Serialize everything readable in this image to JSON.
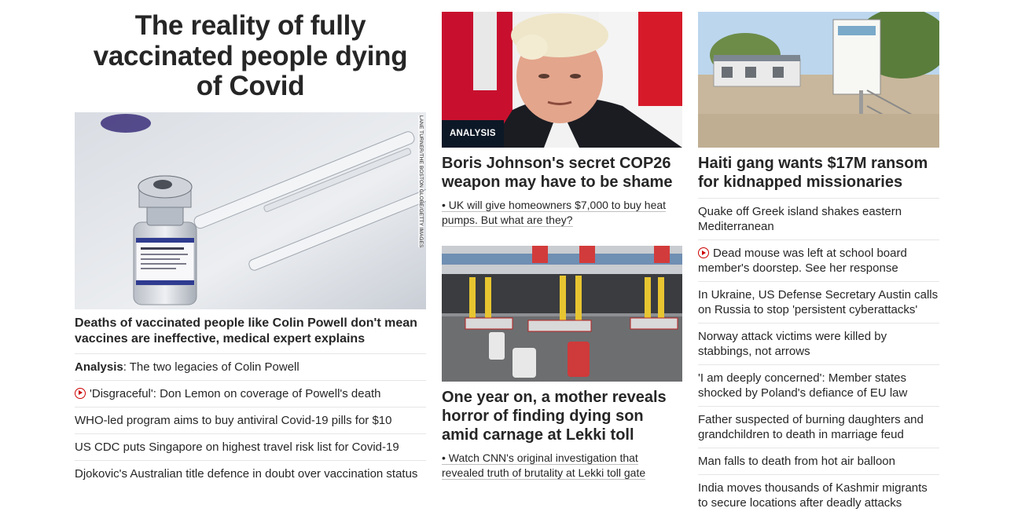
{
  "col1": {
    "lead_title": "The reality of fully vaccinated people dying of Covid",
    "image_credit": "LANE TURNER/THE BOSTON GLOBE/GETTY IMAGES",
    "headline": "Deaths of vaccinated people like Colin Powell don't mean vaccines are ineffective, medical expert explains",
    "items": [
      {
        "prefix": "Analysis",
        "text": ": The two legacies of Colin Powell",
        "video": false
      },
      {
        "prefix": "",
        "text": "'Disgraceful': Don Lemon on coverage of Powell's death",
        "video": true
      },
      {
        "prefix": "",
        "text": "WHO-led program aims to buy antiviral Covid-19 pills for $10",
        "video": false
      },
      {
        "prefix": "",
        "text": "US CDC puts Singapore on highest travel risk list for Covid-19",
        "video": false
      },
      {
        "prefix": "",
        "text": "Djokovic's Australian title defence in doubt over vaccination status",
        "video": false
      }
    ]
  },
  "col2": {
    "story1": {
      "tag": "ANALYSIS",
      "headline": "Boris Johnson's secret COP26 weapon may have to be shame",
      "sub": "• UK will give homeowners $7,000 to buy heat pumps. But what are they?"
    },
    "story2": {
      "headline": "One year on, a mother reveals horror of finding dying son amid carnage at Lekki toll",
      "sub": "• Watch CNN's original investigation that revealed truth of brutality at Lekki toll gate"
    }
  },
  "col3": {
    "headline": "Haiti gang wants $17M ransom for kidnapped missionaries",
    "items": [
      {
        "text": "Quake off Greek island shakes eastern Mediterranean",
        "video": false
      },
      {
        "text": "Dead mouse was left at school board member's doorstep. See her response",
        "video": true
      },
      {
        "text": "In Ukraine, US Defense Secretary Austin calls on Russia to stop 'persistent cyberattacks'",
        "video": false
      },
      {
        "text": "Norway attack victims were killed by stabbings, not arrows",
        "video": false
      },
      {
        "text": "'I am deeply concerned': Member states shocked by Poland's defiance of EU law",
        "video": false
      },
      {
        "text": "Father suspected of burning daughters and grandchildren to death in marriage feud",
        "video": false
      },
      {
        "text": "Man falls to death from hot air balloon",
        "video": false
      },
      {
        "text": "India moves thousands of Kashmir migrants to secure locations after deadly attacks",
        "video": false
      }
    ]
  },
  "icons": {
    "video_play": "play-circle-icon"
  },
  "colors": {
    "text": "#262626",
    "divider": "#e6e6e6",
    "video_red": "#cc0000",
    "analysis_tag_bg": "#0c1826"
  }
}
